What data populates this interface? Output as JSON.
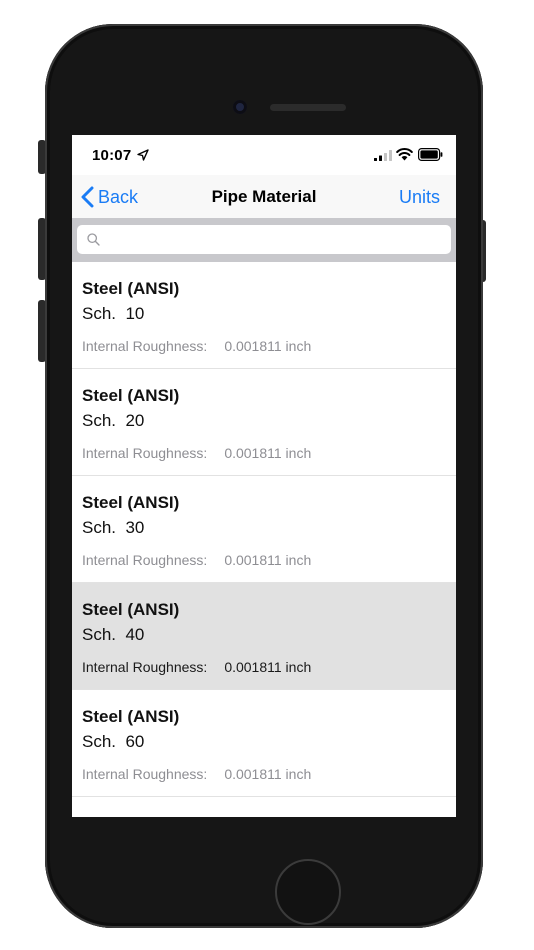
{
  "status_bar": {
    "time": "10:07",
    "icons": [
      "location-arrow-icon",
      "cellular-signal-icon",
      "wifi-icon",
      "battery-icon"
    ]
  },
  "nav": {
    "back_label": "Back",
    "title": "Pipe Material",
    "units_label": "Units"
  },
  "search": {
    "placeholder": "",
    "value": ""
  },
  "colors": {
    "accent": "#1a7cf5",
    "selected_row": "#e1e1e1",
    "search_bar_bg": "#c8c8cc",
    "detail_text": "#8e8e93"
  },
  "materials": [
    {
      "name": "Steel (ANSI)",
      "schedule": "Sch.  10",
      "roughness_label": "Internal Roughness:",
      "roughness_value": "0.001811 inch",
      "selected": false
    },
    {
      "name": "Steel (ANSI)",
      "schedule": "Sch.  20",
      "roughness_label": "Internal Roughness:",
      "roughness_value": "0.001811 inch",
      "selected": false
    },
    {
      "name": "Steel (ANSI)",
      "schedule": "Sch.  30",
      "roughness_label": "Internal Roughness:",
      "roughness_value": "0.001811 inch",
      "selected": false
    },
    {
      "name": "Steel (ANSI)",
      "schedule": "Sch.  40",
      "roughness_label": "Internal Roughness:",
      "roughness_value": "0.001811 inch",
      "selected": true
    },
    {
      "name": "Steel (ANSI)",
      "schedule": "Sch.  60",
      "roughness_label": "Internal Roughness:",
      "roughness_value": "0.001811 inch",
      "selected": false
    }
  ]
}
